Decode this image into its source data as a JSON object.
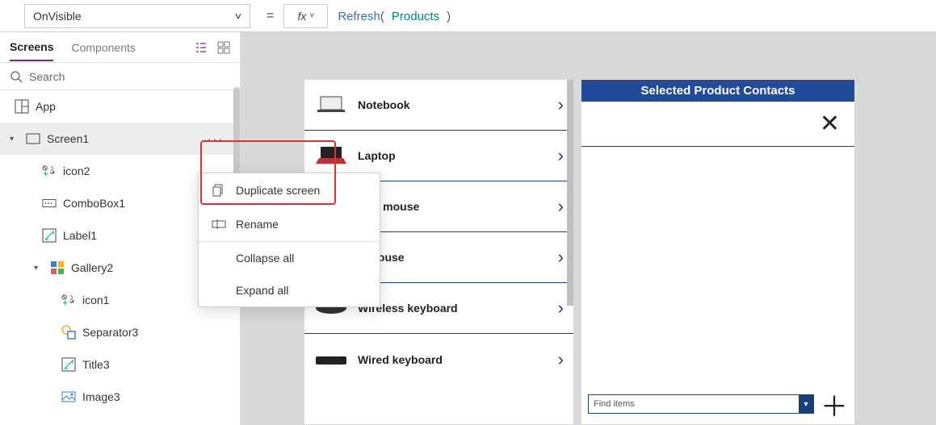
{
  "formula_bar": {
    "property": "OnVisible",
    "fx": "fx",
    "fn": "Refresh",
    "open": "(",
    "arg": "Products",
    "close": ")"
  },
  "tabs": {
    "screens": "Screens",
    "components": "Components"
  },
  "search": {
    "placeholder": "Search"
  },
  "tree": {
    "app": "App",
    "screen1": "Screen1",
    "icon2": "icon2",
    "combobox1": "ComboBox1",
    "label1": "Label1",
    "gallery2": "Gallery2",
    "icon1": "icon1",
    "separator3": "Separator3",
    "title3": "Title3",
    "image3": "Image3"
  },
  "context_menu": {
    "duplicate": "Duplicate screen",
    "rename": "Rename",
    "collapse": "Collapse all",
    "expand": "Expand all"
  },
  "gallery_items": [
    {
      "name": "Notebook"
    },
    {
      "name": "Laptop"
    },
    {
      "name": "Wireless mouse",
      "truncated": "less mouse"
    },
    {
      "name": "Wired mouse",
      "truncated": "d mouse"
    },
    {
      "name": "Wireless keyboard"
    },
    {
      "name": "Wired keyboard"
    }
  ],
  "contacts": {
    "header": "Selected Product Contacts",
    "find_placeholder": "Find items"
  }
}
